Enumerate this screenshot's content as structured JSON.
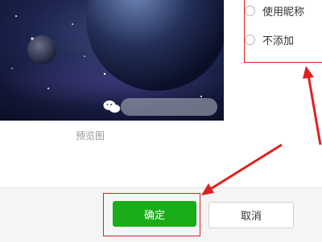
{
  "preview": {
    "caption": "预览图",
    "watermark_icon": "wechat-logo-icon"
  },
  "options": [
    {
      "label": "使用昵称",
      "selected": false
    },
    {
      "label": "不添加",
      "selected": false
    }
  ],
  "footer": {
    "confirm_label": "确定",
    "cancel_label": "取消"
  },
  "colors": {
    "confirm": "#1aad19",
    "annotation": "#e02020",
    "footer_bg": "#f5f5f5"
  }
}
